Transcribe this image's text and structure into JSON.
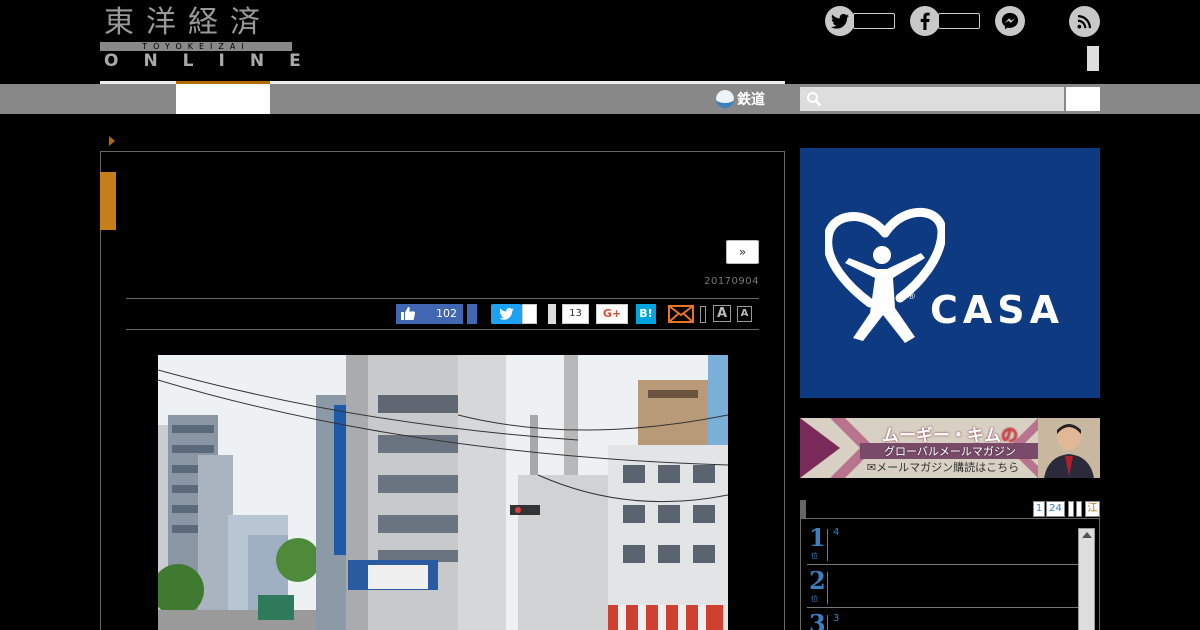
{
  "brand": {
    "kanji": "東洋経済",
    "roman": "TOYOKEIZAI",
    "online": "ONLINE"
  },
  "nav": {
    "rail_label": "鉄道",
    "search_placeholder": ""
  },
  "article": {
    "next_label": "»",
    "date": "20170904"
  },
  "share": {
    "like_count": "102",
    "share_count": "13",
    "gplus_label": "G+",
    "hatena_label": "B!",
    "font_large_label": "A",
    "font_small_label": "A"
  },
  "ads": {
    "casa": {
      "reg_mark": "®",
      "name": "CASA"
    },
    "magazine": {
      "title_main": "ムーギー・キム",
      "title_suffix": "の",
      "subtitle": "グローバルメールマガジン",
      "cta": "✉メールマガジン購読はこちら"
    }
  },
  "ranking": {
    "tabs": [
      "1",
      "24",
      "",
      "",
      "江"
    ],
    "items": [
      {
        "rank": "1",
        "unit": "位",
        "extra": "4"
      },
      {
        "rank": "2",
        "unit": "位",
        "extra": ""
      },
      {
        "rank": "3",
        "unit": "位",
        "extra": "3"
      }
    ]
  },
  "colors": {
    "accent": "#b46a00",
    "facebook": "#4267b2",
    "twitter": "#1da1f2",
    "hatena": "#00a4de",
    "casa_blue": "#0e3a82",
    "rank_blue": "#3a7fc0"
  },
  "icons": [
    "twitter-icon",
    "facebook-icon",
    "messenger-icon",
    "rss-icon",
    "search-icon",
    "thumbs-up-icon",
    "mail-icon",
    "rail-icon"
  ]
}
